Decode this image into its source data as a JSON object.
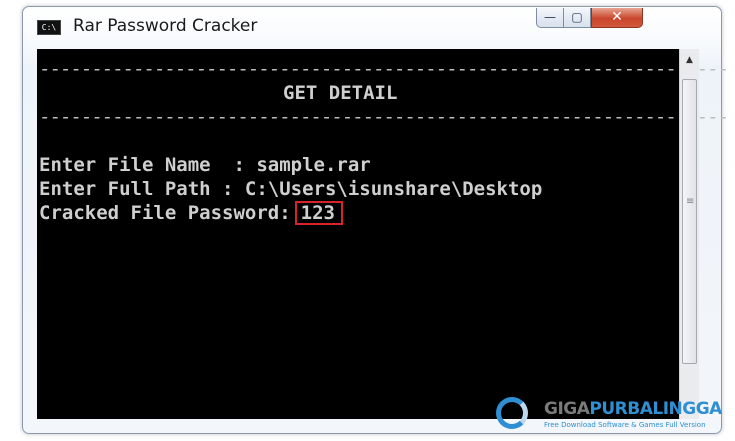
{
  "window": {
    "title": "Rar Password Cracker",
    "icon_label": "C:\\",
    "controls": {
      "minimize": "—",
      "maximize": "▢",
      "close": "✕"
    }
  },
  "console": {
    "dash_line": "------------------------------------------------------------------",
    "heading": "GET DETAIL",
    "lines": {
      "file_name": "Enter File Name  : sample.rar",
      "full_path": "Enter Full Path : C:\\Users\\isunshare\\Desktop",
      "cracked_label": "Cracked File Password:",
      "password": "123"
    }
  },
  "watermark": {
    "brand_part1": "GIGA",
    "brand_part2": "PURBALINGGA",
    "tagline": "Free Download Software & Games Full Version"
  },
  "colors": {
    "console_bg": "#000000",
    "console_text": "#cfcfcf",
    "highlight_box": "#d8232a",
    "close_button": "#c9472c",
    "watermark_blue": "#2e8fd3"
  }
}
